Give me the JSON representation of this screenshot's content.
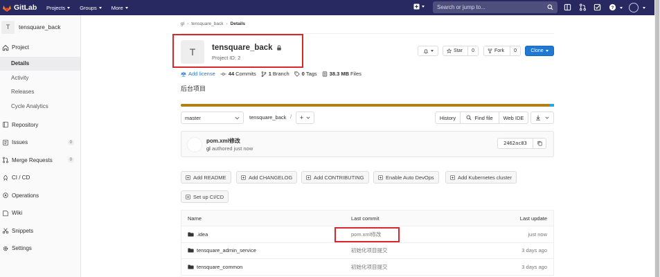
{
  "topbar": {
    "brand": "GitLab",
    "menu": [
      "Projects",
      "Groups",
      "More"
    ],
    "search_placeholder": "Search or jump to..."
  },
  "sidebar": {
    "project_initial": "T",
    "project_name": "tensquare_back",
    "project_section": "Project",
    "project_subitems": [
      "Details",
      "Activity",
      "Releases",
      "Cycle Analytics"
    ],
    "items": [
      {
        "label": "Repository"
      },
      {
        "label": "Issues",
        "count": "0"
      },
      {
        "label": "Merge Requests",
        "count": "0"
      },
      {
        "label": "CI / CD"
      },
      {
        "label": "Operations"
      },
      {
        "label": "Wiki"
      },
      {
        "label": "Snippets"
      },
      {
        "label": "Settings"
      }
    ]
  },
  "breadcrumb": [
    "gl",
    "tensquare_back",
    "Details"
  ],
  "project": {
    "initial": "T",
    "name": "tensquare_back",
    "id_text": "Project ID: 2",
    "star_label": "Star",
    "star_count": "0",
    "fork_label": "Fork",
    "fork_count": "0",
    "clone_label": "Clone"
  },
  "stats": {
    "add_license": "Add license",
    "commits_count": "44",
    "commits_label": "Commits",
    "branch_count": "1",
    "branch_label": "Branch",
    "tags_count": "0",
    "tags_label": "Tags",
    "size_value": "38.3 MB",
    "size_label": "Files"
  },
  "description": "后台项目",
  "repo_toolbar": {
    "branch": "master",
    "path": "tensquare_back",
    "path_sep": "/",
    "history": "History",
    "find_file": "Find file",
    "web_ide": "Web IDE"
  },
  "last_commit": {
    "message": "pom.xml修改",
    "author": "gl",
    "authored_text": "authored just now",
    "sha": "2462ac83"
  },
  "quick_buttons": [
    "Add README",
    "Add CHANGELOG",
    "Add CONTRIBUTING",
    "Enable Auto DevOps",
    "Add Kubernetes cluster",
    "Set up CI/CD"
  ],
  "file_table": {
    "headers": [
      "Name",
      "Last commit",
      "Last update"
    ],
    "rows": [
      {
        "name": ".idea",
        "commit": "pom.xml修改",
        "updated": "just now"
      },
      {
        "name": "tensquare_admin_service",
        "commit": "初始化项目提交",
        "updated": "3 days ago"
      },
      {
        "name": "tensquare_common",
        "commit": "初始化项目提交",
        "updated": "3 days ago"
      }
    ]
  },
  "colors": {
    "navbar": "#292961",
    "accent_blue": "#1f78d1",
    "highlight_red": "#d9262c",
    "language_bar": "#b07f18"
  }
}
